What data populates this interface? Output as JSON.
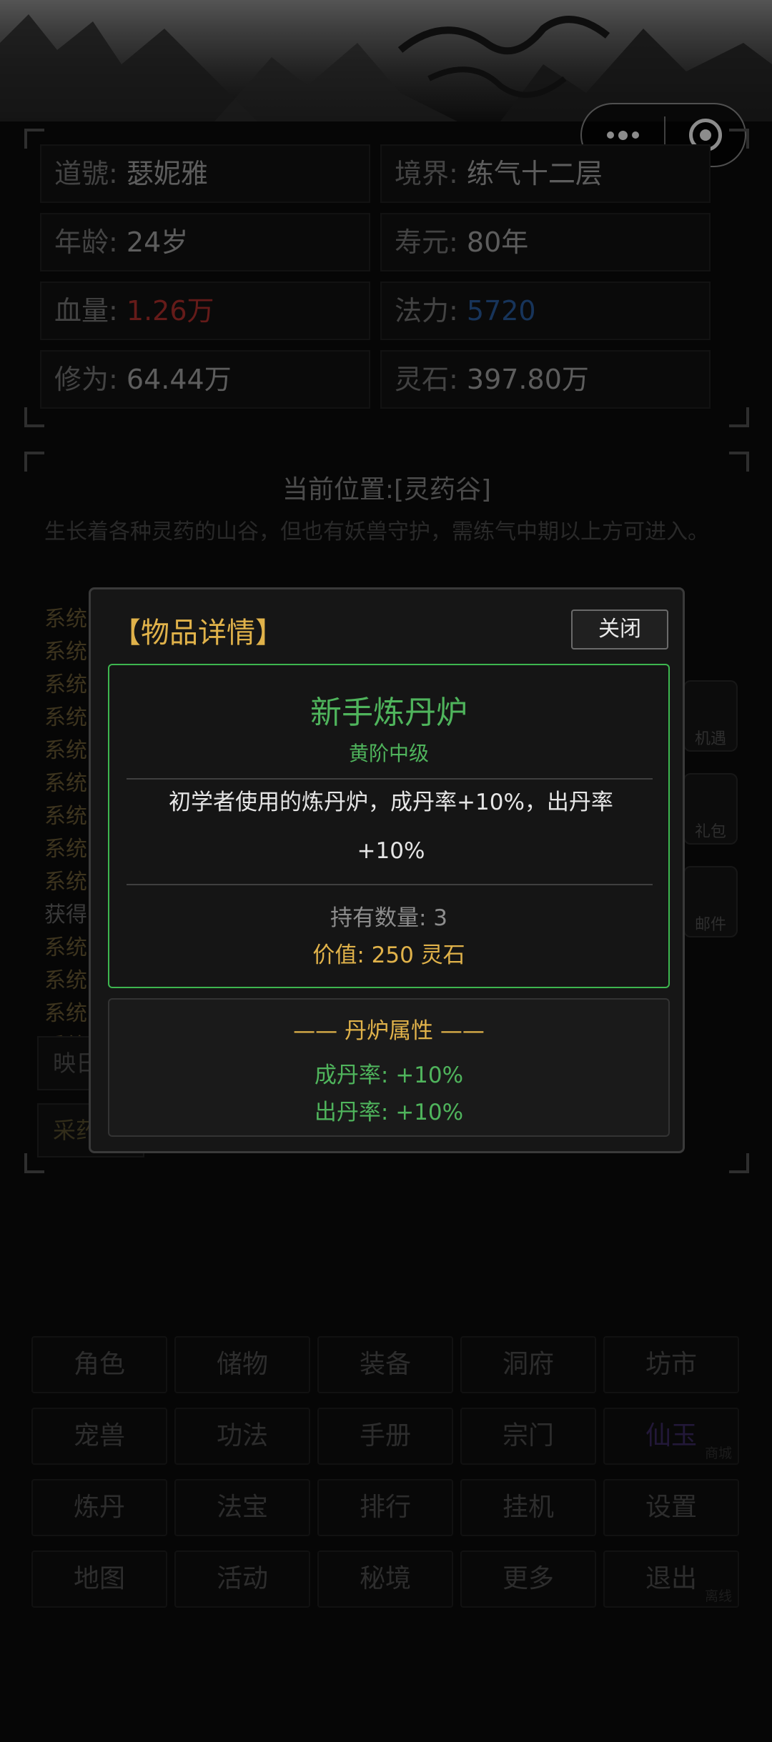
{
  "capsule": {
    "more_icon": "more-dots-icon",
    "close_icon": "target-circle-icon"
  },
  "stats": [
    {
      "label": "道號:",
      "value": "瑟妮雅",
      "color": "normal"
    },
    {
      "label": "境界:",
      "value": "练气十二层",
      "color": "normal"
    },
    {
      "label": "年龄:",
      "value": "24岁",
      "color": "normal"
    },
    {
      "label": "寿元:",
      "value": "80年",
      "color": "normal"
    },
    {
      "label": "血量:",
      "value": "1.26万",
      "color": "red"
    },
    {
      "label": "法力:",
      "value": "5720",
      "color": "blue"
    },
    {
      "label": "修为:",
      "value": "64.44万",
      "color": "normal"
    },
    {
      "label": "灵石:",
      "value": "397.80万",
      "color": "normal"
    }
  ],
  "location": {
    "title": "当前位置:[灵药谷]",
    "description": "生长着各种灵药的山谷，但也有妖兽守护，需练气中期以上方可进入。",
    "logs": [
      "系统",
      "系统",
      "系统",
      "系统",
      "系统",
      "系统",
      "系统",
      "系统",
      "系统",
      "获得",
      "系统",
      "系统",
      "系统",
      "系统"
    ],
    "buttons": [
      "映日",
      "采药"
    ],
    "side_icons": [
      "机遇",
      "礼包",
      "邮件"
    ]
  },
  "modal": {
    "title": "【物品详情】",
    "close_label": "关闭",
    "item_name": "新手炼丹炉",
    "item_grade": "黄阶中级",
    "item_desc": "初学者使用的炼丹炉，成丹率+10%，出丹率+10%",
    "qty": "持有数量: 3",
    "value": "价值: 250 灵石",
    "attr_title": "—— 丹炉属性 ——",
    "attrs": [
      "成丹率: +10%",
      "出丹率: +10%"
    ]
  },
  "menu": [
    {
      "label": "角色",
      "sub": ""
    },
    {
      "label": "储物",
      "sub": ""
    },
    {
      "label": "装备",
      "sub": ""
    },
    {
      "label": "洞府",
      "sub": ""
    },
    {
      "label": "坊市",
      "sub": ""
    },
    {
      "label": "宠兽",
      "sub": ""
    },
    {
      "label": "功法",
      "sub": ""
    },
    {
      "label": "手册",
      "sub": ""
    },
    {
      "label": "宗门",
      "sub": ""
    },
    {
      "label": "仙玉",
      "sub": "商城",
      "color": "purple"
    },
    {
      "label": "炼丹",
      "sub": ""
    },
    {
      "label": "法宝",
      "sub": ""
    },
    {
      "label": "排行",
      "sub": ""
    },
    {
      "label": "挂机",
      "sub": ""
    },
    {
      "label": "设置",
      "sub": ""
    },
    {
      "label": "地图",
      "sub": ""
    },
    {
      "label": "活动",
      "sub": ""
    },
    {
      "label": "秘境",
      "sub": ""
    },
    {
      "label": "更多",
      "sub": ""
    },
    {
      "label": "退出",
      "sub": "离线"
    }
  ]
}
